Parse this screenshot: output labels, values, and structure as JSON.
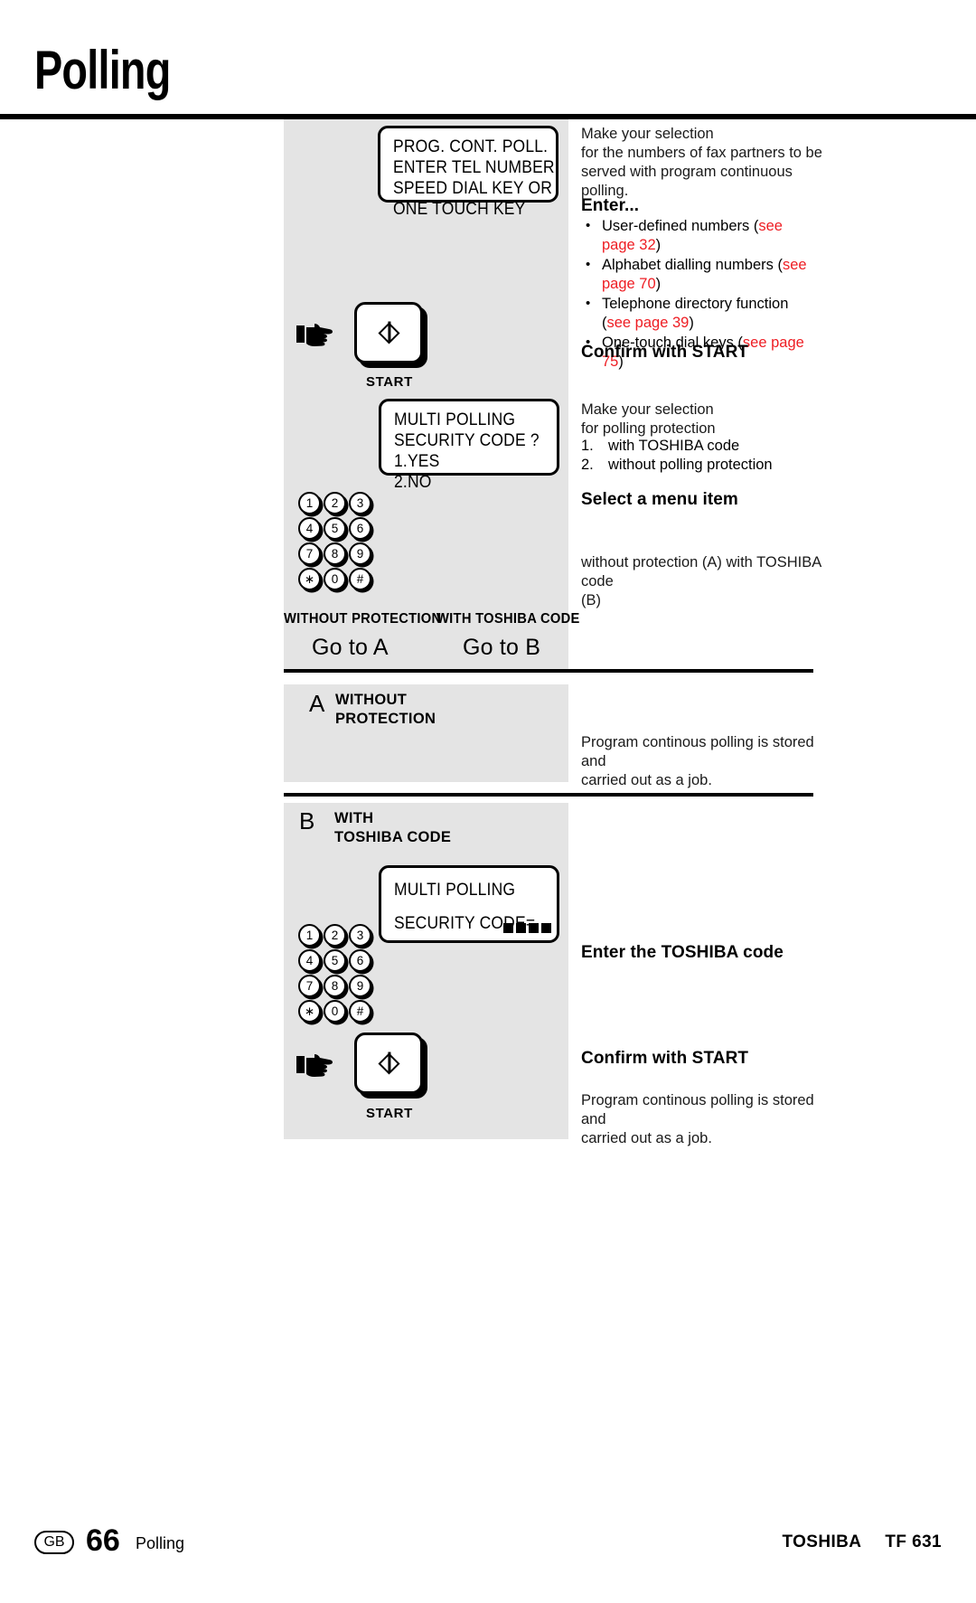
{
  "page": {
    "title": "Polling",
    "footer": {
      "locale": "GB",
      "number": "66",
      "section": "Polling",
      "brand": "TOSHIBA",
      "model": "TF 631"
    }
  },
  "step1": {
    "lcd": [
      "PROG. CONT. POLL.",
      "ENTER TEL NUMBER",
      "SPEED DIAL KEY OR",
      "ONE TOUCH KEY"
    ],
    "intro": [
      "Make your selection",
      "for the numbers of fax partners to be",
      "served with program continuous polling."
    ],
    "enter_heading": "Enter...",
    "bullets": [
      {
        "text": "User-defined numbers (",
        "ref": "see page 32",
        "tail": ")"
      },
      {
        "text": "Alphabet dialling numbers (",
        "ref": "see page 70",
        "tail": ")"
      },
      {
        "text": "Telephone directory function (",
        "ref": "see page 39",
        "tail": ")"
      },
      {
        "text": "One-touch dial keys (",
        "ref": "see page 75",
        "tail": ")"
      }
    ],
    "confirm": "Confirm with START",
    "start_label": "START"
  },
  "step2": {
    "lcd": [
      "MULTI POLLING",
      "SECURITY CODE ?",
      "1.YES",
      "2.NO"
    ],
    "intro": [
      "Make your selection",
      "for polling protection"
    ],
    "options": [
      {
        "num": "1.",
        "text": "with TOSHIBA code"
      },
      {
        "num": "2.",
        "text": "without polling protection"
      }
    ],
    "select_heading": "Select a menu item",
    "note": [
      "without protection (A) with TOSHIBA code",
      "(B)"
    ]
  },
  "keypad": {
    "rows": [
      [
        "1",
        "2",
        "3"
      ],
      [
        "4",
        "5",
        "6"
      ],
      [
        "7",
        "8",
        "9"
      ],
      [
        "∗",
        "0",
        "#"
      ]
    ]
  },
  "tabs": [
    {
      "label": "WITHOUT PROTECTION",
      "action": "Go to A"
    },
    {
      "label": "WITH TOSHIBA CODE",
      "action": "Go to B"
    }
  ],
  "section_a": {
    "letter": "A",
    "title": [
      "WITHOUT",
      "PROTECTION"
    ],
    "result": [
      "Program continous polling is stored and",
      "carried out as a job."
    ]
  },
  "section_b": {
    "letter": "B",
    "title": [
      "WITH",
      "TOSHIBA CODE"
    ],
    "lcd_line1": "MULTI POLLING",
    "lcd_line2": "SECURITY CODE=",
    "lcd_blocks": 4,
    "enter_code": "Enter the TOSHIBA code",
    "confirm": "Confirm with START",
    "start_label": "START",
    "result": [
      "Program continous polling is stored and",
      "carried out as a job."
    ]
  }
}
